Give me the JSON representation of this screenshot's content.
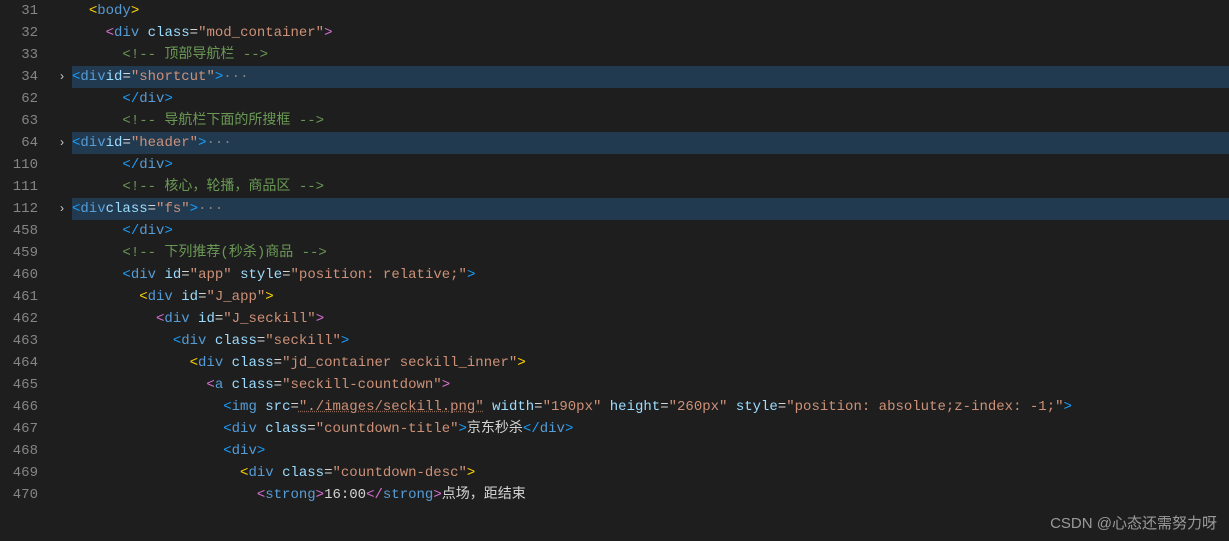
{
  "watermark": "CSDN @心态还需努力呀",
  "line_numbers": [
    "31",
    "32",
    "33",
    "34",
    "62",
    "63",
    "64",
    "110",
    "111",
    "112",
    "458",
    "459",
    "460",
    "461",
    "462",
    "463",
    "464",
    "465",
    "466",
    "467",
    "468",
    "469",
    "470"
  ],
  "fold_markers": {
    "34": "exp",
    "64": "exp",
    "112": "exp"
  },
  "highlighted_lines": [
    "34",
    "64",
    "112"
  ],
  "tokens": {
    "body": "body",
    "div": "div",
    "a": "a",
    "img": "img",
    "strong": "strong",
    "class_attr": "class",
    "id_attr": "id",
    "style_attr": "style",
    "src_attr": "src",
    "width_attr": "width",
    "height_attr": "height",
    "position_relative": "\"position: relative;\"",
    "position_absolute": "\"position: absolute;z-index: -1;\"",
    "mod_container": "\"mod_container\"",
    "shortcut": "\"shortcut\"",
    "header": "\"header\"",
    "fs": "\"fs\"",
    "app": "\"app\"",
    "j_app": "\"J_app\"",
    "j_seckill": "\"J_seckill\"",
    "seckill": "\"seckill\"",
    "jd_container_inner": "\"jd_container seckill_inner\"",
    "seckill_countdown": "\"seckill-countdown\"",
    "img_src": "\"./images/seckill.png\"",
    "w190": "\"190px\"",
    "h260": "\"260px\"",
    "countdown_title": "\"countdown-title\"",
    "countdown_title_text": "京东秒杀",
    "countdown_desc": "\"countdown-desc\"",
    "time_1600": "16:00",
    "clock_text": "点场，距结束",
    "comment_topnav": "<!-- 顶部导航栏 -->",
    "comment_searchbox": "<!-- 导航栏下面的所搜框 -->",
    "comment_core": "<!-- 核心，轮播，商品区 -->",
    "comment_recommend": "<!-- 下列推荐(秒杀)商品 -->",
    "fold_dots": "···"
  }
}
